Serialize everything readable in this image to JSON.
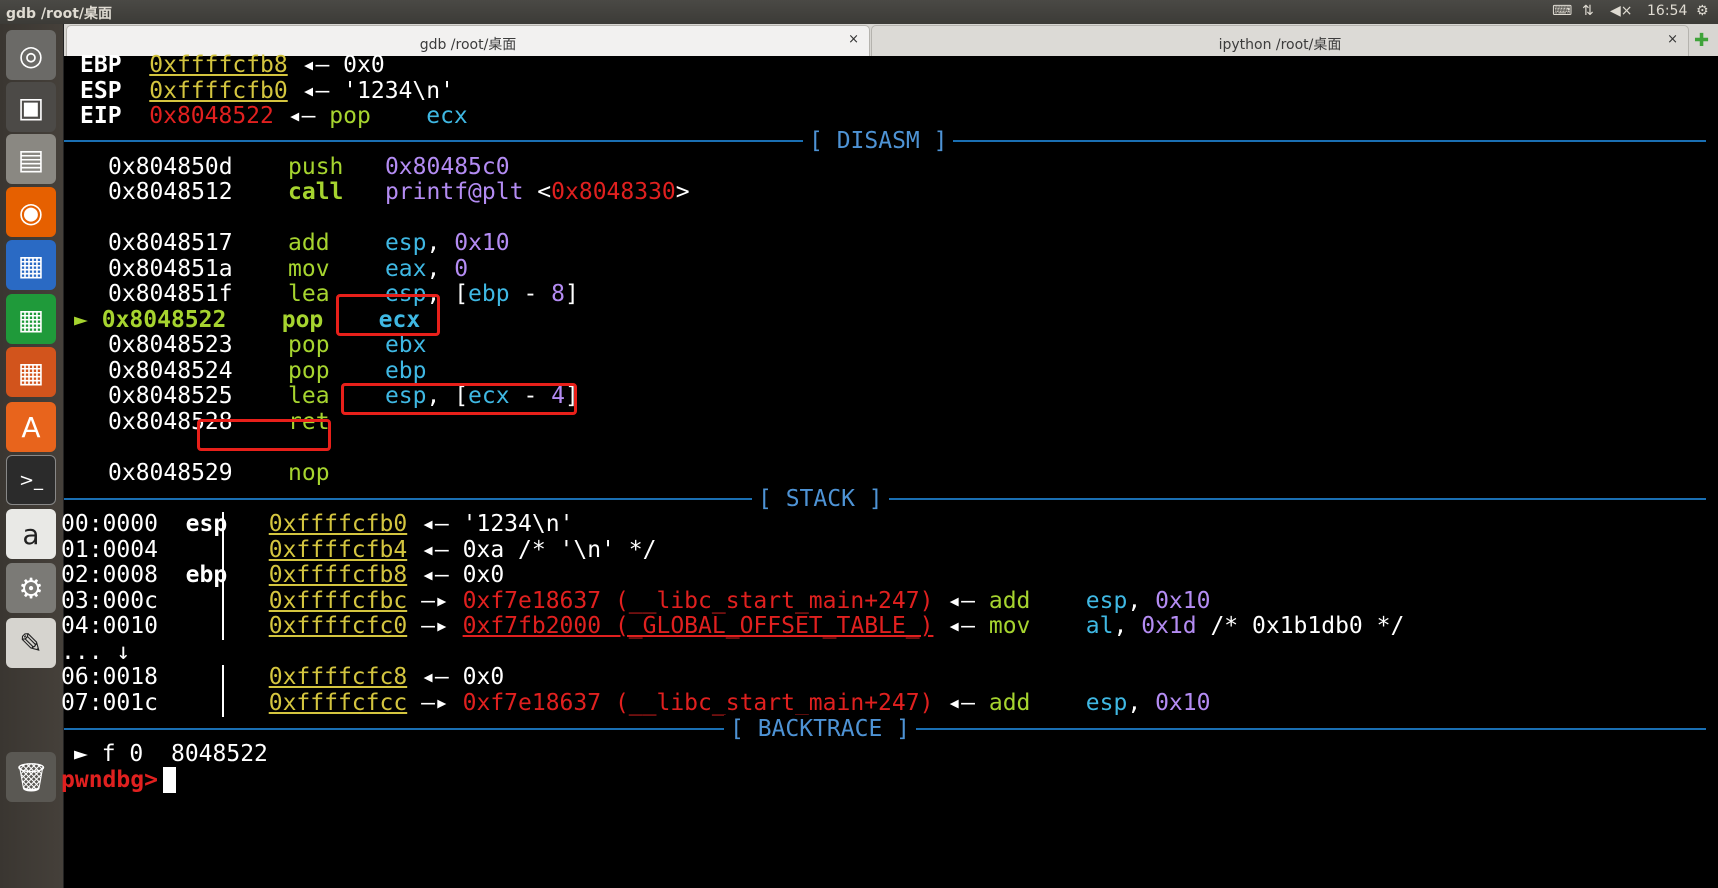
{
  "topbar": {
    "window_title": "gdb  /root/桌面",
    "keyboard_icon": "keyboard-icon",
    "network_icon": "network-icon",
    "volume_label": "◀×",
    "clock": "16:54"
  },
  "launcher": {
    "items": [
      {
        "name": "ubuntu-dash-icon",
        "glyph": "◎",
        "bg": "#6b6a67"
      },
      {
        "name": "workspace-switcher-icon",
        "glyph": "▣",
        "bg": "#4c4a47"
      },
      {
        "name": "files-icon",
        "glyph": "▤",
        "bg": "#8a8882"
      },
      {
        "name": "firefox-icon",
        "glyph": "◉",
        "bg": "#e66000"
      },
      {
        "name": "writer-icon",
        "glyph": "▦",
        "bg": "#2a6ac4"
      },
      {
        "name": "calc-icon",
        "glyph": "▦",
        "bg": "#1f9a3a"
      },
      {
        "name": "impress-icon",
        "glyph": "▦",
        "bg": "#d2541c"
      },
      {
        "name": "software-center-icon",
        "glyph": "A",
        "bg": "#e8641c"
      },
      {
        "name": "terminal-icon",
        "glyph": ">_",
        "bg": "#2b2b2b"
      },
      {
        "name": "amazon-icon",
        "glyph": "a",
        "bg": "#e9e9e6"
      },
      {
        "name": "system-settings-icon",
        "glyph": "⚙",
        "bg": "#7b7a76"
      },
      {
        "name": "text-editor-icon",
        "glyph": "✎",
        "bg": "#d6d4cf"
      },
      {
        "name": "trash-icon",
        "glyph": "🗑",
        "bg": "#5a5853"
      }
    ]
  },
  "tabs": [
    {
      "label": "gdb  /root/桌面",
      "close": "×"
    },
    {
      "label": "ipython  /root/桌面",
      "close": "×"
    }
  ],
  "tab_add": "✚",
  "tab_menu": "▼",
  "registers": {
    "ebp": {
      "name": "EBP",
      "addr": "0xffffcfb8",
      "arrow": "◂—",
      "val": "0x0"
    },
    "esp": {
      "name": "ESP",
      "addr": "0xffffcfb0",
      "arrow": "◂—",
      "val": "'1234\\n'"
    },
    "eip": {
      "name": "EIP",
      "addr": "0x8048522",
      "arrow": "◂—",
      "op": "pop",
      "arg": "ecx"
    }
  },
  "sections": {
    "disasm": "[ DISASM ]",
    "stack": "[ STACK ]",
    "backtrace": "[ BACKTRACE ]"
  },
  "disasm": {
    "marker": "►",
    "l1": {
      "addr": "0x804850d",
      "op": "push",
      "arg": "0x80485c0"
    },
    "l2": {
      "addr": "0x8048512",
      "op": "call",
      "fn": "printf@plt",
      "lt": "<",
      "target": "0x8048330",
      "gt": ">"
    },
    "l3": {
      "addr": "0x8048517",
      "op": "add",
      "reg": "esp",
      "comma": ",",
      "imm": "0x10"
    },
    "l4": {
      "addr": "0x804851a",
      "op": "mov",
      "reg": "eax",
      "comma": ",",
      "imm": "0"
    },
    "l5": {
      "addr": "0x804851f",
      "op": "lea",
      "reg": "esp",
      "open": ", [",
      "base": "ebp",
      "minus": " - ",
      "off": "8",
      "close": "]"
    },
    "l6": {
      "addr": "0x8048522",
      "op": "pop",
      "reg": "ecx"
    },
    "l7": {
      "addr": "0x8048523",
      "op": "pop",
      "reg": "ebx"
    },
    "l8": {
      "addr": "0x8048524",
      "op": "pop",
      "reg": "ebp"
    },
    "l9": {
      "addr": "0x8048525",
      "op": "lea",
      "reg": "esp",
      "open": ", [",
      "base": "ecx",
      "minus": " - ",
      "off": "4",
      "close": "]"
    },
    "l10": {
      "addr": "0x8048528",
      "op": "ret"
    },
    "l11": {
      "addr": "0x8048529",
      "op": "nop"
    }
  },
  "stack": {
    "r0": {
      "idx": "00:0000",
      "reg": "esp",
      "addr": "0xffffcfb0",
      "arrow": "◂—",
      "val": "'1234\\n'"
    },
    "r1": {
      "idx": "01:0004",
      "addr": "0xffffcfb4",
      "arrow": "◂—",
      "val": "0xa /* '\\n' */"
    },
    "r2": {
      "idx": "02:0008",
      "reg": "ebp",
      "addr": "0xffffcfb8",
      "arrow": "◂—",
      "val": "0x0"
    },
    "r3": {
      "idx": "03:000c",
      "addr": "0xffffcfbc",
      "arrow": "—▸",
      "ptr": "0xf7e18637 (__libc_start_main+247)",
      "arrow2": "◂—",
      "op": "add",
      "reg": "esp",
      "comma": ",",
      "imm": "0x10"
    },
    "r4": {
      "idx": "04:0010",
      "addr": "0xffffcfc0",
      "arrow": "—▸",
      "ptr": "0xf7fb2000 (_GLOBAL_OFFSET_TABLE_)",
      "arrow2": "◂—",
      "op": "mov",
      "reg": "al",
      "comma": ",",
      "imm": "0x1d",
      "comment": " /* 0x1b1db0 */"
    },
    "ellipsis": "... ↓",
    "r6": {
      "idx": "06:0018",
      "addr": "0xffffcfc8",
      "arrow": "◂—",
      "val": "0x0"
    },
    "r7": {
      "idx": "07:001c",
      "addr": "0xffffcfcc",
      "arrow": "—▸",
      "ptr": "0xf7e18637 (__libc_start_main+247)",
      "arrow2": "◂—",
      "op": "add",
      "reg": "esp",
      "comma": ",",
      "imm": "0x10"
    }
  },
  "backtrace": {
    "marker": "►",
    "frame": "f 0",
    "addr": "8048522"
  },
  "prompt": "pwndbg>"
}
